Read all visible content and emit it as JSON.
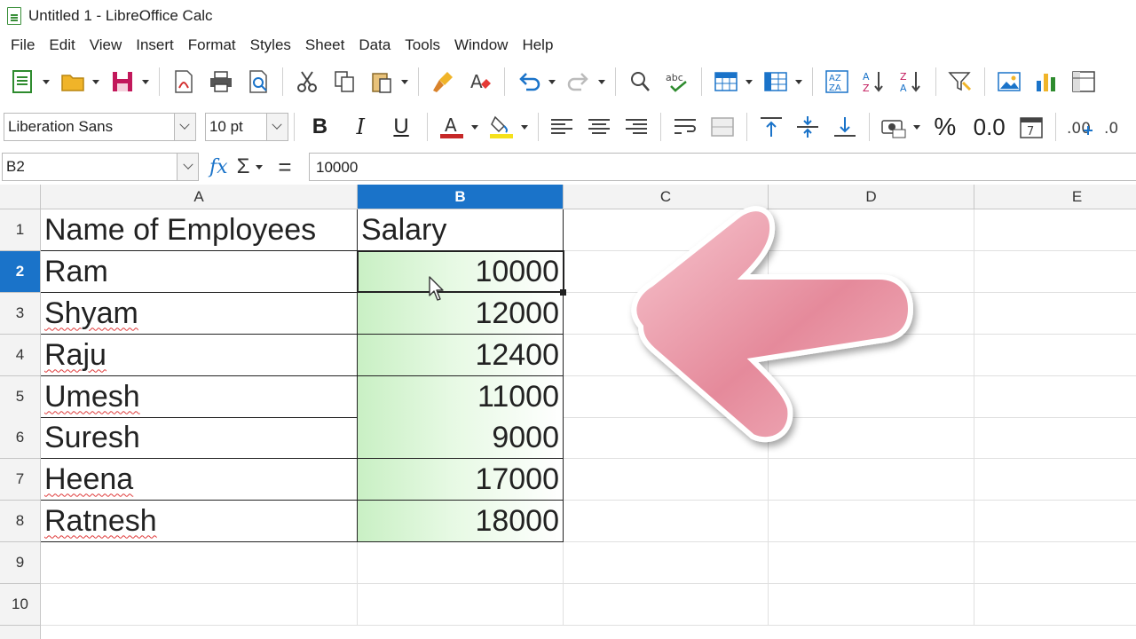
{
  "window": {
    "title": "Untitled 1 - LibreOffice Calc"
  },
  "menu": [
    "File",
    "Edit",
    "View",
    "Insert",
    "Format",
    "Styles",
    "Sheet",
    "Data",
    "Tools",
    "Window",
    "Help"
  ],
  "format_bar": {
    "font_name": "Liberation Sans",
    "font_size": "10 pt",
    "bold_label": "B",
    "italic_label": "I",
    "underline_label": "U",
    "percent_label": "%",
    "decimal_label": "0.0"
  },
  "formula_bar": {
    "name_box": "B2",
    "function_wizard": "fx",
    "sum_symbol": "Σ",
    "equals_symbol": "=",
    "content": "10000"
  },
  "columns": [
    "A",
    "B",
    "C",
    "D",
    "E"
  ],
  "rows": [
    "1",
    "2",
    "3",
    "4",
    "5",
    "6",
    "7",
    "8",
    "9",
    "10"
  ],
  "selected": {
    "column": "B",
    "row": "2"
  },
  "cells": {
    "A1": "Name of Employees",
    "B1": "Salary",
    "A2": "Ram",
    "B2": "10000",
    "A3": "Shyam",
    "B3": "12000",
    "A4": "Raju",
    "B4": "12400",
    "A5": "Umesh",
    "B5": "11000",
    "A6": "Suresh",
    "B6": "9000",
    "A7": "Heena",
    "B7": "17000",
    "A8": "Ratnesh",
    "B8": "18000"
  },
  "colors": {
    "accent": "#1a73c9",
    "salary_fill": "#c9f0c4",
    "overlay_arrow": "#e78a9b"
  }
}
